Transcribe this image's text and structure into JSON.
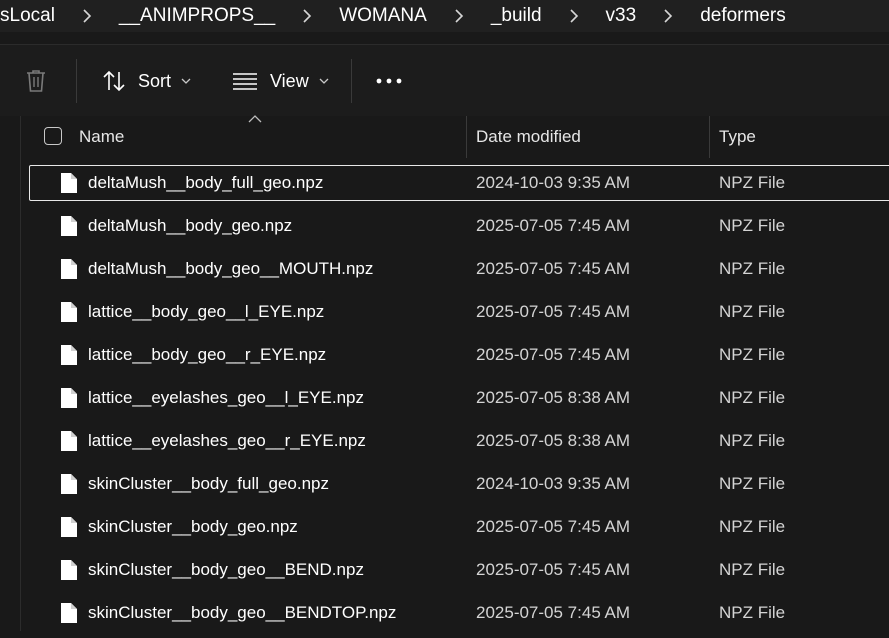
{
  "breadcrumb": [
    "sLocal",
    "__ANIMPROPS__",
    "WOMANA",
    "_build",
    "v33",
    "deformers"
  ],
  "toolbar": {
    "sort_label": "Sort",
    "view_label": "View"
  },
  "columns": {
    "name": "Name",
    "date": "Date modified",
    "type": "Type"
  },
  "files": [
    {
      "name": "deltaMush__body_full_geo.npz",
      "date": "2024-10-03 9:35 AM",
      "type": "NPZ File",
      "selected": true
    },
    {
      "name": "deltaMush__body_geo.npz",
      "date": "2025-07-05 7:45 AM",
      "type": "NPZ File"
    },
    {
      "name": "deltaMush__body_geo__MOUTH.npz",
      "date": "2025-07-05 7:45 AM",
      "type": "NPZ File"
    },
    {
      "name": "lattice__body_geo__l_EYE.npz",
      "date": "2025-07-05 7:45 AM",
      "type": "NPZ File"
    },
    {
      "name": "lattice__body_geo__r_EYE.npz",
      "date": "2025-07-05 7:45 AM",
      "type": "NPZ File"
    },
    {
      "name": "lattice__eyelashes_geo__l_EYE.npz",
      "date": "2025-07-05 8:38 AM",
      "type": "NPZ File"
    },
    {
      "name": "lattice__eyelashes_geo__r_EYE.npz",
      "date": "2025-07-05 8:38 AM",
      "type": "NPZ File"
    },
    {
      "name": "skinCluster__body_full_geo.npz",
      "date": "2024-10-03 9:35 AM",
      "type": "NPZ File"
    },
    {
      "name": "skinCluster__body_geo.npz",
      "date": "2025-07-05 7:45 AM",
      "type": "NPZ File"
    },
    {
      "name": "skinCluster__body_geo__BEND.npz",
      "date": "2025-07-05 7:45 AM",
      "type": "NPZ File"
    },
    {
      "name": "skinCluster__body_geo__BENDTOP.npz",
      "date": "2025-07-05 7:45 AM",
      "type": "NPZ File"
    }
  ],
  "icons": {
    "delete": "trash-icon",
    "sort": "sort-arrows-icon",
    "view": "view-lines-icon",
    "more": "more-dots-icon",
    "file": "file-icon",
    "separator": "chevron-right-icon"
  }
}
